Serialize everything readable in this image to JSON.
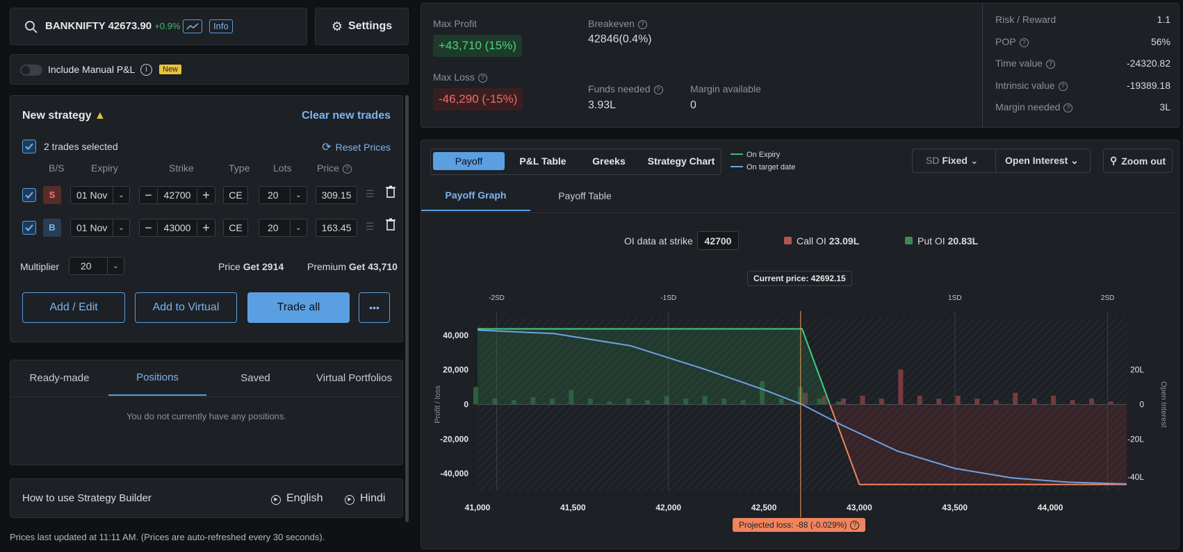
{
  "header": {
    "symbol": "BANKNIFTY",
    "price": "42673.90",
    "change": "+0.9%",
    "info": "Info",
    "settings": "Settings"
  },
  "manual": {
    "label": "Include Manual P&L",
    "badge": "New"
  },
  "strategy": {
    "title": "New strategy",
    "clear": "Clear new trades",
    "selected": "2 trades selected",
    "reset": "Reset Prices",
    "cols": {
      "bs": "B/S",
      "expiry": "Expiry",
      "strike": "Strike",
      "type": "Type",
      "lots": "Lots",
      "price": "Price"
    },
    "trades": [
      {
        "bs": "S",
        "expiry": "01 Nov",
        "strike": "42700",
        "type": "CE",
        "lots": "20",
        "price": "309.15"
      },
      {
        "bs": "B",
        "expiry": "01 Nov",
        "strike": "43000",
        "type": "CE",
        "lots": "20",
        "price": "163.45"
      }
    ],
    "multiplier_label": "Multiplier",
    "multiplier": "20",
    "price_label": "Price",
    "price_value": "Get 2914",
    "premium_label": "Premium",
    "premium_value": "Get 43,710",
    "buttons": {
      "add_edit": "Add / Edit",
      "add_virtual": "Add to Virtual",
      "trade_all": "Trade all",
      "more": "•••"
    }
  },
  "lower_tabs": [
    "Ready-made",
    "Positions",
    "Saved",
    "Virtual Portfolios"
  ],
  "positions_empty": "You do not currently have any positions.",
  "howto": {
    "title": "How to use Strategy Builder",
    "english": "English",
    "hindi": "Hindi"
  },
  "footer": "Prices last updated at 11:11 AM. (Prices are auto-refreshed every 30 seconds).",
  "summary": {
    "max_profit_label": "Max Profit",
    "max_profit": "+43,710 (15%)",
    "max_loss_label": "Max Loss",
    "max_loss": "-46,290 (-15%)",
    "breakeven_label": "Breakeven",
    "breakeven": "42846(0.4%)",
    "funds_label": "Funds needed",
    "funds": "3.93L",
    "margin_avail_label": "Margin available",
    "margin_avail": "0"
  },
  "stats": [
    {
      "label": "Risk / Reward",
      "value": "1.1",
      "help": false
    },
    {
      "label": "POP",
      "value": "56%",
      "help": true
    },
    {
      "label": "Time value",
      "value": "-24320.82",
      "help": true
    },
    {
      "label": "Intrinsic value",
      "value": "-19389.18",
      "help": true
    },
    {
      "label": "Margin needed",
      "value": "3L",
      "help": true
    }
  ],
  "chart_tabs": [
    "Payoff",
    "P&L Table",
    "Greeks",
    "Strategy Chart"
  ],
  "legend": {
    "expiry": "On Expiry",
    "target": "On target date"
  },
  "sd": {
    "label": "SD",
    "value": "Fixed"
  },
  "oi_dropdown": "Open Interest",
  "zoom": "Zoom out",
  "sub_tabs": [
    "Payoff Graph",
    "Payoff Table"
  ],
  "oi_info": {
    "label": "OI data at strike",
    "strike": "42700",
    "call_label": "Call OI",
    "call": "23.09L",
    "put_label": "Put OI",
    "put": "20.83L"
  },
  "current_price": "Current price: 42692.15",
  "projected": "Projected loss: -88 (-0.029%)",
  "colors": {
    "green": "#3fbf6f",
    "red": "#e05a5a",
    "blue": "#5b9fe3",
    "bg": "#1d2025"
  },
  "chart_data": {
    "type": "line",
    "xlabel": "",
    "ylabel": "Profit / loss",
    "y2label": "Open Interest",
    "x_ticks": [
      "41,000",
      "41,500",
      "42,000",
      "42,500",
      "43,000",
      "43,500",
      "44,000"
    ],
    "y_ticks": [
      "40,000",
      "20,000",
      "0",
      "-20,000",
      "-40,000"
    ],
    "y2_ticks": [
      "20L",
      "0",
      "-20L",
      "-40L"
    ],
    "sd_labels": [
      "-2SD",
      "-1SD",
      "1SD",
      "2SD"
    ],
    "xlim": [
      41000,
      44400
    ],
    "ylim": [
      -50000,
      50000
    ],
    "expiry_payoff": {
      "x": [
        41000,
        42700,
        43000,
        44400
      ],
      "y": [
        43710,
        43710,
        -46290,
        -46290
      ]
    },
    "target_payoff": {
      "x": [
        41000,
        41400,
        41800,
        42200,
        42500,
        42700,
        42900,
        43200,
        43500,
        43800,
        44100,
        44400
      ],
      "y": [
        43000,
        41000,
        34000,
        20000,
        8500,
        0,
        -11500,
        -27000,
        -37000,
        -42500,
        -45000,
        -46000
      ]
    },
    "put_oi": {
      "x": [
        41000,
        41100,
        41200,
        41300,
        41400,
        41500,
        41600,
        41700,
        41800,
        41900,
        42000,
        42100,
        42200,
        42300,
        42400,
        42500,
        42600,
        42700,
        42800,
        42900
      ],
      "values": [
        6,
        2,
        1.5,
        2.5,
        2,
        5,
        2,
        1,
        2,
        1.5,
        3,
        2,
        3,
        2,
        1.5,
        8,
        2,
        6,
        2,
        1
      ]
    },
    "call_oi": {
      "x": [
        42700,
        42800,
        42900,
        43000,
        43100,
        43200,
        43300,
        43400,
        43500,
        43600,
        43700,
        43800,
        43900,
        44000,
        44100,
        44200,
        44300
      ],
      "values": [
        4,
        3,
        2,
        3,
        2,
        12,
        3,
        2,
        3,
        2,
        1.5,
        4,
        2,
        3,
        1.5,
        2,
        1
      ]
    }
  }
}
